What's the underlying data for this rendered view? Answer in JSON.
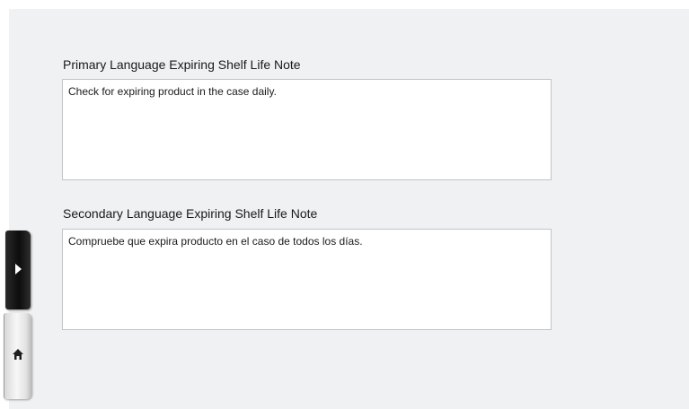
{
  "notes": {
    "primary": {
      "label": "Primary Language Expiring Shelf Life Note",
      "value": "Check for expiring product in the case daily."
    },
    "secondary": {
      "label": "Secondary Language Expiring Shelf Life Note",
      "value": "Compruebe que expira producto en el caso de todos los días."
    }
  },
  "side_rail": {
    "expand_icon": "chevron-right-icon",
    "home_icon": "home-icon"
  },
  "colors": {
    "background": "#f0f1f2",
    "field_border": "#c2c4c6",
    "text": "#1a1a1a"
  }
}
